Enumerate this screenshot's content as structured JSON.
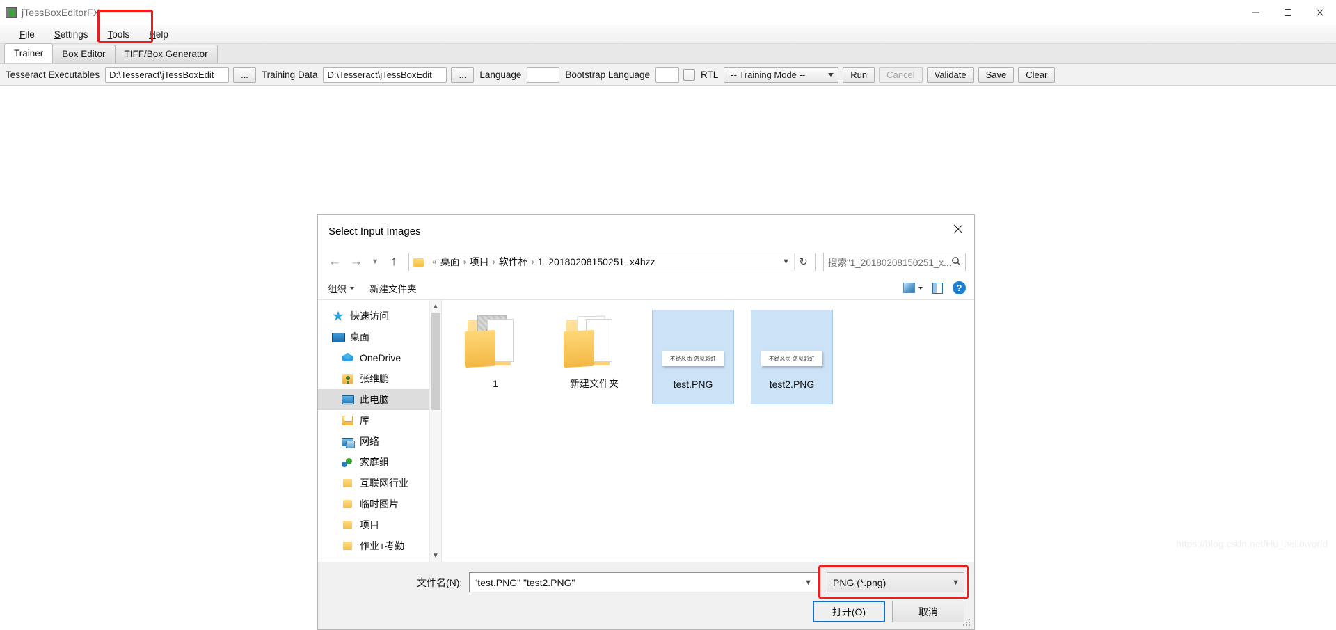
{
  "window": {
    "title": "jTessBoxEditorFX",
    "icon": "app-icon",
    "controls": {
      "minimize": "minimize-icon",
      "maximize": "maximize-icon",
      "close": "close-icon"
    }
  },
  "menu": {
    "items": [
      {
        "label": "File",
        "mnemonic": "F"
      },
      {
        "label": "Settings",
        "mnemonic": "S"
      },
      {
        "label": "Tools",
        "mnemonic": "T"
      },
      {
        "label": "Help",
        "mnemonic": "H"
      }
    ],
    "highlight_color": "#ee1c1c",
    "highlighted_item": "Tools"
  },
  "tabs": [
    {
      "label": "Trainer",
      "active": true
    },
    {
      "label": "Box Editor",
      "active": false
    },
    {
      "label": "TIFF/Box Generator",
      "active": false
    }
  ],
  "toolbar": {
    "tesseract_label": "Tesseract Executables",
    "tesseract_value": "D:\\Tesseract\\jTessBoxEdit",
    "tesseract_browse": "...",
    "training_data_label": "Training Data",
    "training_data_value": "D:\\Tesseract\\jTessBoxEdit",
    "training_data_browse": "...",
    "language_label": "Language",
    "language_value": "",
    "bootstrap_label": "Bootstrap Language",
    "bootstrap_value": "",
    "rtl_label": "RTL",
    "rtl_checked": false,
    "mode_value": "-- Training Mode --",
    "buttons": [
      {
        "label": "Run",
        "disabled": false
      },
      {
        "label": "Cancel",
        "disabled": true
      },
      {
        "label": "Validate",
        "disabled": false
      },
      {
        "label": "Save",
        "disabled": false
      },
      {
        "label": "Clear",
        "disabled": false
      }
    ]
  },
  "dialog": {
    "title": "Select Input Images",
    "close_icon": "close-icon",
    "nav": {
      "back_icon": "arrow-left-icon",
      "forward_icon": "arrow-right-icon",
      "recent_icon": "chevron-down-icon",
      "up_icon": "arrow-up-icon",
      "folder_icon": "folder-icon",
      "breadcrumb_prefix": "«",
      "breadcrumb": [
        "桌面",
        "项目",
        "软件杯",
        "1_20180208150251_x4hzz"
      ],
      "address_caret_icon": "chevron-down-icon",
      "refresh_icon": "refresh-icon",
      "search_placeholder": "搜索\"1_20180208150251_x...",
      "search_icon": "search-icon"
    },
    "commandbar": {
      "organize_label": "组织",
      "new_folder_label": "新建文件夹",
      "view_icon": "view-layout-icon",
      "view_caret_icon": "chevron-down-icon",
      "preview_pane_icon": "preview-pane-icon",
      "help_icon": "help-icon",
      "help_glyph": "?"
    },
    "sidebar": {
      "items": [
        {
          "label": "快速访问",
          "icon": "star-icon",
          "indent": 0,
          "selected": false
        },
        {
          "label": "桌面",
          "icon": "desktop-icon",
          "indent": 0,
          "selected": false
        },
        {
          "label": "OneDrive",
          "icon": "cloud-icon",
          "indent": 1,
          "selected": false
        },
        {
          "label": "张维鹏",
          "icon": "user-icon",
          "indent": 1,
          "selected": false
        },
        {
          "label": "此电脑",
          "icon": "pc-icon",
          "indent": 1,
          "selected": true
        },
        {
          "label": "库",
          "icon": "library-icon",
          "indent": 1,
          "selected": false
        },
        {
          "label": "网络",
          "icon": "network-icon",
          "indent": 1,
          "selected": false
        },
        {
          "label": "家庭组",
          "icon": "homegroup-icon",
          "indent": 1,
          "selected": false
        },
        {
          "label": "互联网行业",
          "icon": "folder-icon",
          "indent": 1,
          "selected": false
        },
        {
          "label": "临时图片",
          "icon": "folder-icon",
          "indent": 1,
          "selected": false
        },
        {
          "label": "项目",
          "icon": "folder-icon",
          "indent": 1,
          "selected": false
        },
        {
          "label": "作业+考勤",
          "icon": "folder-icon",
          "indent": 1,
          "selected": false
        }
      ],
      "scroll_up_icon": "chevron-up-icon",
      "scroll_down_icon": "chevron-down-icon"
    },
    "files": [
      {
        "name": "1",
        "type": "folder",
        "selected": false,
        "preview_text": ""
      },
      {
        "name": "新建文件夹",
        "type": "folder",
        "selected": false,
        "preview_text": ""
      },
      {
        "name": "test.PNG",
        "type": "image",
        "selected": true,
        "preview_text": "不经风雨 怎见彩虹"
      },
      {
        "name": "test2.PNG",
        "type": "image",
        "selected": true,
        "preview_text": "不经风雨 怎见彩虹"
      }
    ],
    "footer": {
      "filename_label": "文件名(N):",
      "filename_value": "\"test.PNG\" \"test2.PNG\"",
      "filename_caret_icon": "chevron-down-icon",
      "filetype_value": "PNG (*.png)",
      "filetype_caret_icon": "chevron-down-icon",
      "filetype_highlight_color": "#ee1c1c",
      "open_button": "打开(O)",
      "cancel_button": "取消",
      "resize_grip_icon": "resize-grip-icon"
    }
  },
  "watermark": "https://blog.csdn.net/Hu_helloworld"
}
